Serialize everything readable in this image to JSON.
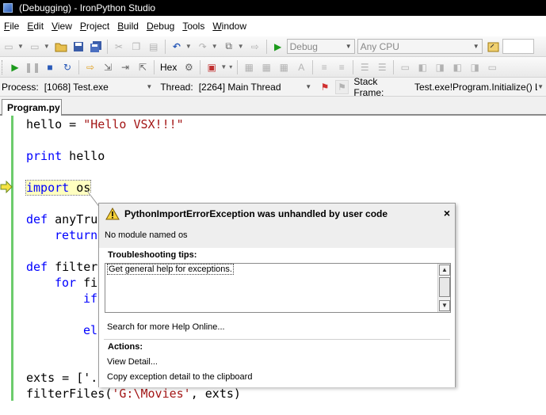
{
  "window": {
    "title": "(Debugging) - IronPython Studio"
  },
  "menu": [
    {
      "label": "File",
      "acc": "F",
      "rest": "ile"
    },
    {
      "label": "Edit",
      "acc": "E",
      "rest": "dit"
    },
    {
      "label": "View",
      "acc": "V",
      "rest": "iew"
    },
    {
      "label": "Project",
      "acc": "P",
      "rest": "roject"
    },
    {
      "label": "Build",
      "acc": "B",
      "rest": "uild"
    },
    {
      "label": "Debug",
      "acc": "D",
      "rest": "ebug"
    },
    {
      "label": "Tools",
      "acc": "T",
      "rest": "ools"
    },
    {
      "label": "Window",
      "acc": "W",
      "rest": "indow"
    }
  ],
  "toolbar1": {
    "config": "Debug",
    "platform": "Any CPU"
  },
  "toolbar2": {
    "hex_label": "Hex"
  },
  "debug_location": {
    "process_label": "Process:",
    "process_value": "[1068] Test.exe",
    "thread_label": "Thread:",
    "thread_value": "[2264] Main Thread",
    "stack_label": "Stack Frame:",
    "stack_value": "Test.exe!Program.Initialize() Lir"
  },
  "tabs": [
    {
      "label": "Program.py"
    }
  ],
  "code": {
    "l1_var": "hello = ",
    "l1_str": "\"Hello VSX!!!\"",
    "l2_kw": "print",
    "l2_rest": " hello",
    "l3_kw": "import",
    "l3_rest": " os",
    "l4_kw": "def",
    "l4_rest": " anyTru",
    "l5_kw": "return",
    "l6_kw": "def",
    "l6_rest": " filter",
    "l7_kw": "for",
    "l7_rest": " fi",
    "l8_kw": "if",
    "l9_kw": "el",
    "l10": "exts = ['.",
    "l11_a": "filterFiles(",
    "l11_str": "'G:\\Movies'",
    "l11_b": ", exts)"
  },
  "exception": {
    "title": "PythonImportErrorException was unhandled by user code",
    "message": "No module named os",
    "tips_title": "Troubleshooting tips:",
    "tip_link": "Get general help for exceptions.",
    "help_online": "Search for more Help Online...",
    "actions_title": "Actions:",
    "action_view": "View Detail...",
    "action_copy": "Copy exception detail to the clipboard",
    "close_glyph": "×"
  }
}
